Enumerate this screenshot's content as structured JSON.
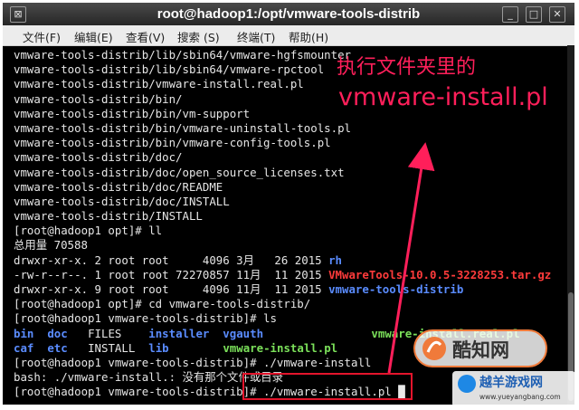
{
  "window": {
    "title": "root@hadoop1:/opt/vmware-tools-distrib",
    "buttons": {
      "menu": "⊠",
      "minimize": "_",
      "maximize": "□",
      "close": "✕"
    }
  },
  "menu": [
    "文件(F)",
    "编辑(E)",
    "查看(V)",
    "搜索 (S)",
    "终端(T)",
    "帮助(H)"
  ],
  "terminal_lines": [
    [
      {
        "t": "vmware-tools-distrib/lib/sbin64/vmware-hgfsmounter"
      }
    ],
    [
      {
        "t": "vmware-tools-distrib/lib/sbin64/vmware-rpctool"
      }
    ],
    [
      {
        "t": "vmware-tools-distrib/vmware-install.real.pl"
      }
    ],
    [
      {
        "t": "vmware-tools-distrib/bin/"
      }
    ],
    [
      {
        "t": "vmware-tools-distrib/bin/vm-support"
      }
    ],
    [
      {
        "t": "vmware-tools-distrib/bin/vmware-uninstall-tools.pl"
      }
    ],
    [
      {
        "t": "vmware-tools-distrib/bin/vmware-config-tools.pl"
      }
    ],
    [
      {
        "t": "vmware-tools-distrib/doc/"
      }
    ],
    [
      {
        "t": "vmware-tools-distrib/doc/open_source_licenses.txt"
      }
    ],
    [
      {
        "t": "vmware-tools-distrib/doc/README"
      }
    ],
    [
      {
        "t": "vmware-tools-distrib/doc/INSTALL"
      }
    ],
    [
      {
        "t": "vmware-tools-distrib/INSTALL"
      }
    ],
    [
      {
        "t": "[root@hadoop1 opt]# ll"
      }
    ],
    [
      {
        "t": "总用量 70588"
      }
    ],
    [
      {
        "t": "drwxr-xr-x. 2 root root     4096 3月   26 2015 "
      },
      {
        "t": "rh",
        "c": "blue"
      }
    ],
    [
      {
        "t": "-rw-r--r--. 1 root root 72270857 11月  11 2015 "
      },
      {
        "t": "VMwareTools-10.0.5-3228253.tar.gz",
        "c": "red"
      }
    ],
    [
      {
        "t": "drwxr-xr-x. 9 root root     4096 11月  11 2015 "
      },
      {
        "t": "vmware-tools-distrib",
        "c": "blue"
      }
    ],
    [
      {
        "t": "[root@hadoop1 opt]# cd vmware-tools-distrib/"
      }
    ],
    [
      {
        "t": "[root@hadoop1 vmware-tools-distrib]# ls"
      }
    ],
    [
      {
        "t": "bin",
        "c": "blue"
      },
      {
        "t": "  "
      },
      {
        "t": "doc",
        "c": "blue"
      },
      {
        "t": "   FILES    "
      },
      {
        "t": "installer",
        "c": "blue"
      },
      {
        "t": "  "
      },
      {
        "t": "vgauth",
        "c": "blue"
      },
      {
        "t": "                "
      },
      {
        "t": "vmware-install.real.pl",
        "c": "green"
      }
    ],
    [
      {
        "t": "caf",
        "c": "blue"
      },
      {
        "t": "  "
      },
      {
        "t": "etc",
        "c": "blue"
      },
      {
        "t": "   INSTALL  "
      },
      {
        "t": "lib",
        "c": "blue"
      },
      {
        "t": "        "
      },
      {
        "t": "vmware-install.pl",
        "c": "green"
      }
    ],
    [
      {
        "t": "[root@hadoop1 vmware-tools-distrib]# ./vmware-install"
      }
    ],
    [
      {
        "t": "bash: ./vmware-install.: 没有那个文件或目录"
      }
    ],
    [
      {
        "t": "[root@hadoop1 vmware-tools-distrib]# ./vmware-install.pl "
      },
      {
        "t": "█",
        "c": "cursor"
      }
    ]
  ],
  "colors": {
    "blue": "#5a8cff",
    "green": "#7be05a",
    "red": "#ff3b3b",
    "cursor": "#eaeaea",
    "annotation": "#ff1f5a"
  },
  "annotations": {
    "line1": "执行文件夹里的",
    "line2": "vmware-install.pl"
  },
  "watermarks": [
    {
      "text": "酷知网"
    },
    {
      "text": "越羊游戏网"
    },
    {
      "text": "www.yueyangbang.com"
    }
  ]
}
